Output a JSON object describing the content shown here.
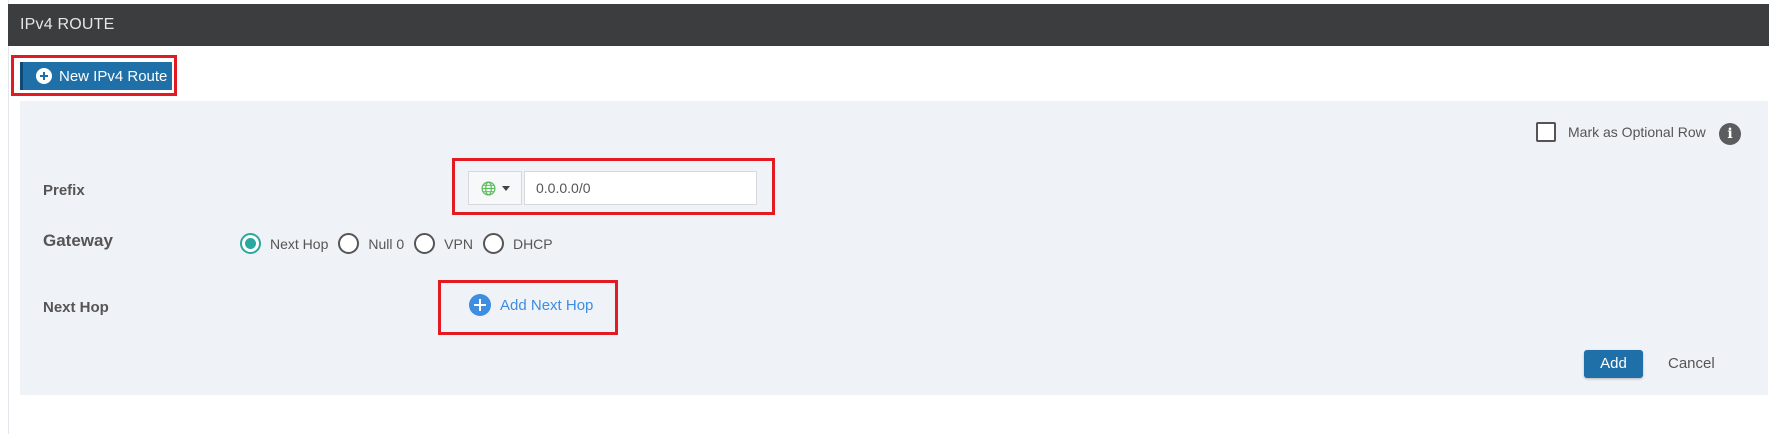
{
  "header": {
    "title": "IPv4 ROUTE"
  },
  "toolbar": {
    "new_route_label": "New IPv4 Route"
  },
  "form": {
    "optional_row_label": "Mark as Optional Row",
    "optional_row_checked": false,
    "info_icon_glyph": "i",
    "prefix": {
      "label": "Prefix",
      "type_icon": "globe-icon",
      "value": "0.0.0.0/0"
    },
    "gateway": {
      "label": "Gateway",
      "options": [
        {
          "label": "Next Hop",
          "selected": true
        },
        {
          "label": "Null 0",
          "selected": false
        },
        {
          "label": "VPN",
          "selected": false
        },
        {
          "label": "DHCP",
          "selected": false
        }
      ]
    },
    "next_hop": {
      "label": "Next Hop",
      "add_label": "Add Next Hop"
    },
    "actions": {
      "add_label": "Add",
      "cancel_label": "Cancel"
    }
  },
  "colors": {
    "header_bg": "#3c3d3f",
    "primary_button": "#1f6fa8",
    "link_blue": "#3d8de0",
    "radio_selected": "#2aa8a0",
    "highlight_border": "#e21b23",
    "panel_bg": "#eff2f6"
  }
}
